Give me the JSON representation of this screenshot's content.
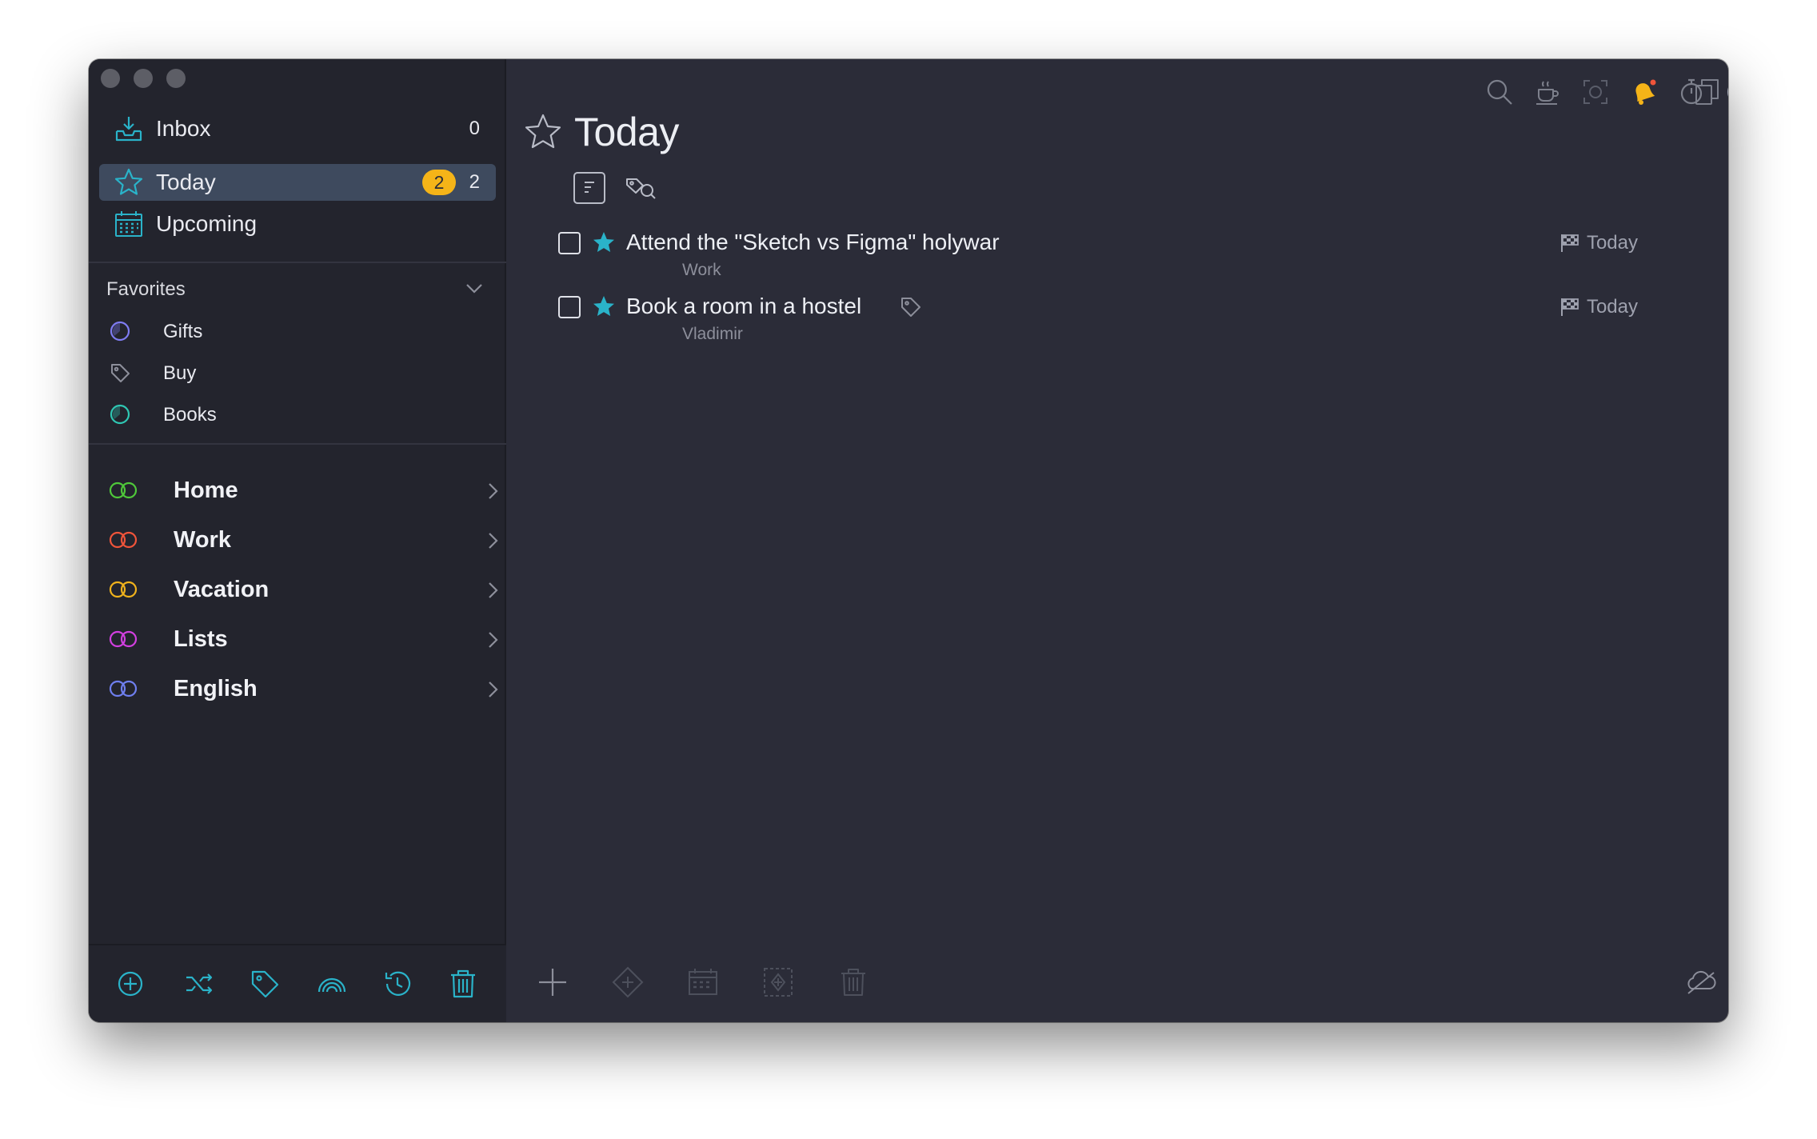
{
  "sidebar": {
    "nav": [
      {
        "label": "Inbox",
        "count": "0"
      },
      {
        "label": "Today",
        "badge": "2",
        "count": "2"
      },
      {
        "label": "Upcoming"
      }
    ],
    "favorites": {
      "header": "Favorites",
      "items": [
        {
          "label": "Gifts",
          "icon": "project-circle-icon",
          "color": "#7f7cf2"
        },
        {
          "label": "Buy",
          "icon": "tag-icon",
          "color": "#8d8f9b"
        },
        {
          "label": "Books",
          "icon": "project-circle-icon",
          "color": "#2fc7b3"
        }
      ]
    },
    "areas": [
      {
        "label": "Home",
        "color": "#4fc83a"
      },
      {
        "label": "Work",
        "color": "#f0543a"
      },
      {
        "label": "Vacation",
        "color": "#f0b21c"
      },
      {
        "label": "Lists",
        "color": "#d23fe0"
      },
      {
        "label": "English",
        "color": "#6f7ff0"
      }
    ],
    "bottom_actions": [
      "add-project-icon",
      "shuffle-icon",
      "tag-icon",
      "rainbow-icon",
      "history-icon",
      "trash-icon"
    ]
  },
  "main": {
    "title": "Today",
    "tasks": [
      {
        "title": "Attend the \"Sketch vs Figma\" holywar",
        "subtitle": "Work",
        "due": "Today",
        "has_tag": false
      },
      {
        "title": "Book a room in a hostel",
        "subtitle": "Vladimir",
        "due": "Today",
        "has_tag": true
      }
    ],
    "toolbar_icons": [
      "search-icon",
      "coffee-icon",
      "focus-icon",
      "notification-bell-icon",
      "timer-icon",
      "theme-contrast-icon",
      "copy-window-icon"
    ],
    "bottom_actions": [
      "add-task-icon",
      "add-subtask-icon",
      "schedule-icon",
      "move-icon",
      "delete-icon",
      "sync-off-icon"
    ]
  },
  "colors": {
    "accent": "#2ab3c9",
    "badge": "#f5b418",
    "selected_bg": "#3e4a5e",
    "sidebar_bg": "#23242d",
    "main_bg": "#2b2c38"
  }
}
